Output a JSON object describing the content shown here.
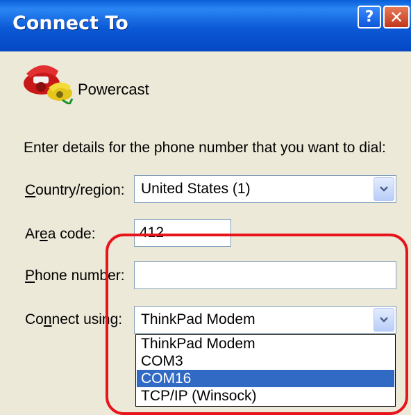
{
  "window": {
    "title": "Connect To",
    "help_button": "?",
    "close_button": "✕"
  },
  "connection": {
    "name": "Powercast",
    "icon": "phone-icon"
  },
  "instructions": "Enter details for the phone number that you want to dial:",
  "fields": {
    "country": {
      "label_pre": "",
      "label_key": "C",
      "label_post": "ountry/region:",
      "value": "United States (1)"
    },
    "area_code": {
      "label_pre": "Ar",
      "label_key": "e",
      "label_post": "a code:",
      "value": "412"
    },
    "phone": {
      "label_pre": "",
      "label_key": "P",
      "label_post": "hone number:",
      "value": ""
    },
    "connect_using": {
      "label_pre": "Co",
      "label_key": "n",
      "label_post": "nect using:",
      "value": "ThinkPad Modem",
      "options": [
        {
          "label": "ThinkPad Modem",
          "selected": false
        },
        {
          "label": "COM3",
          "selected": false
        },
        {
          "label": "COM16",
          "selected": true
        },
        {
          "label": "TCP/IP (Winsock)",
          "selected": false
        }
      ]
    }
  },
  "colors": {
    "titlebar": "#0b59d6",
    "dialog_bg": "#ece9d8",
    "selection": "#316ac5",
    "highlight_ring": "#e8141b"
  }
}
